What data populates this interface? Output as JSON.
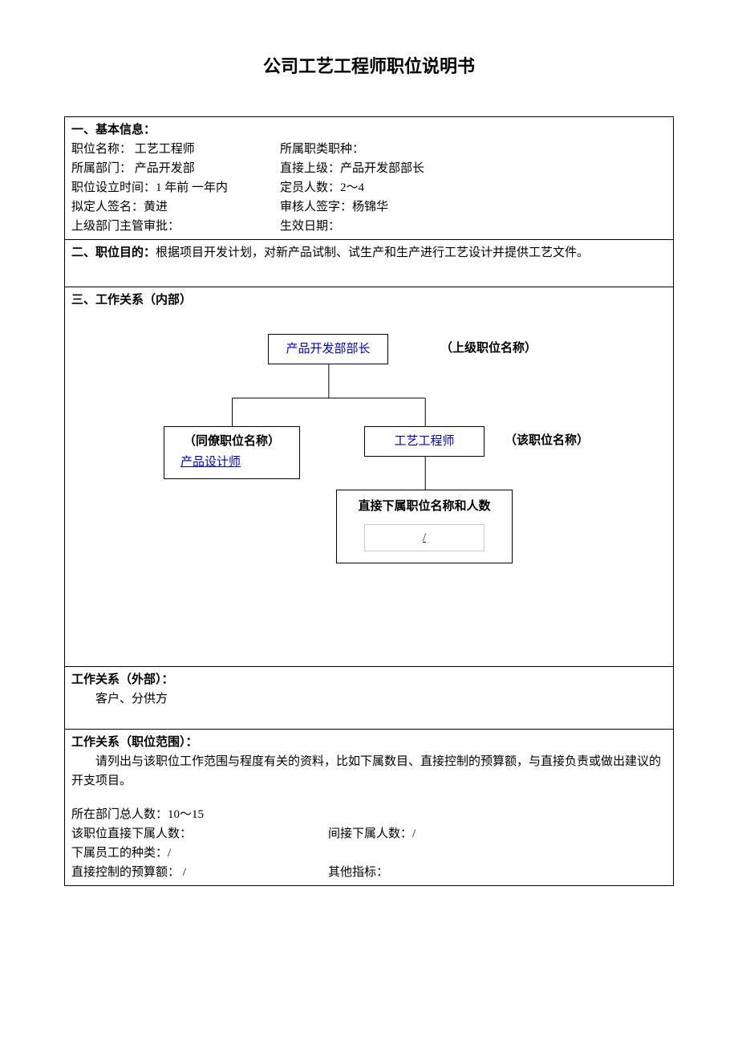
{
  "title": "公司工艺工程师职位说明书",
  "s1": {
    "heading": "一、基本信息：",
    "r1a": "职位名称：  工艺工程师",
    "r1b": "所属职类职种：",
    "r2a": "所属部门：  产品开发部",
    "r2b": "直接上级：产品开发部部长",
    "r3a": "职位设立时间：1 年前   一年内",
    "r3b": "定员人数：2～4",
    "r4a": "拟定人签名：黄进",
    "r4b": "审核人签字：杨锦华",
    "r5a": "上级部门主管审批：",
    "r5b": "生效日期："
  },
  "s2": {
    "heading": "二、职位目的：",
    "text": "根据项目开发计划，对新产品试制、试生产和生产进行工艺设计并提供工艺文件。"
  },
  "s3": {
    "heading": "三、工作关系（内部）",
    "top_box": "产品开发部部长",
    "top_label": "（上级职位名称）",
    "peer_label": "（同僚职位名称）",
    "peer_link": "产品设计师",
    "self_box": "工艺工程师",
    "self_label": "（该职位名称）",
    "sub_box": "直接下属职位名称和人数",
    "sub_link": "/"
  },
  "s4": {
    "heading": "工作关系（外部）：",
    "text": "客户、分供方"
  },
  "s5": {
    "heading": "工作关系（职位范围）：",
    "text": "请列出与该职位工作范围与程度有关的资料，比如下属数目、直接控制的预算额，与直接负责或做出建议的开支项目。",
    "r1": "所在部门总人数：10～15",
    "r2a": "该职位直接下属人数：",
    "r2b": "间接下属人数：/",
    "r3": "下属员工的种类：/",
    "r4a": "直接控制的预算额：   /",
    "r4b": "其他指标："
  }
}
